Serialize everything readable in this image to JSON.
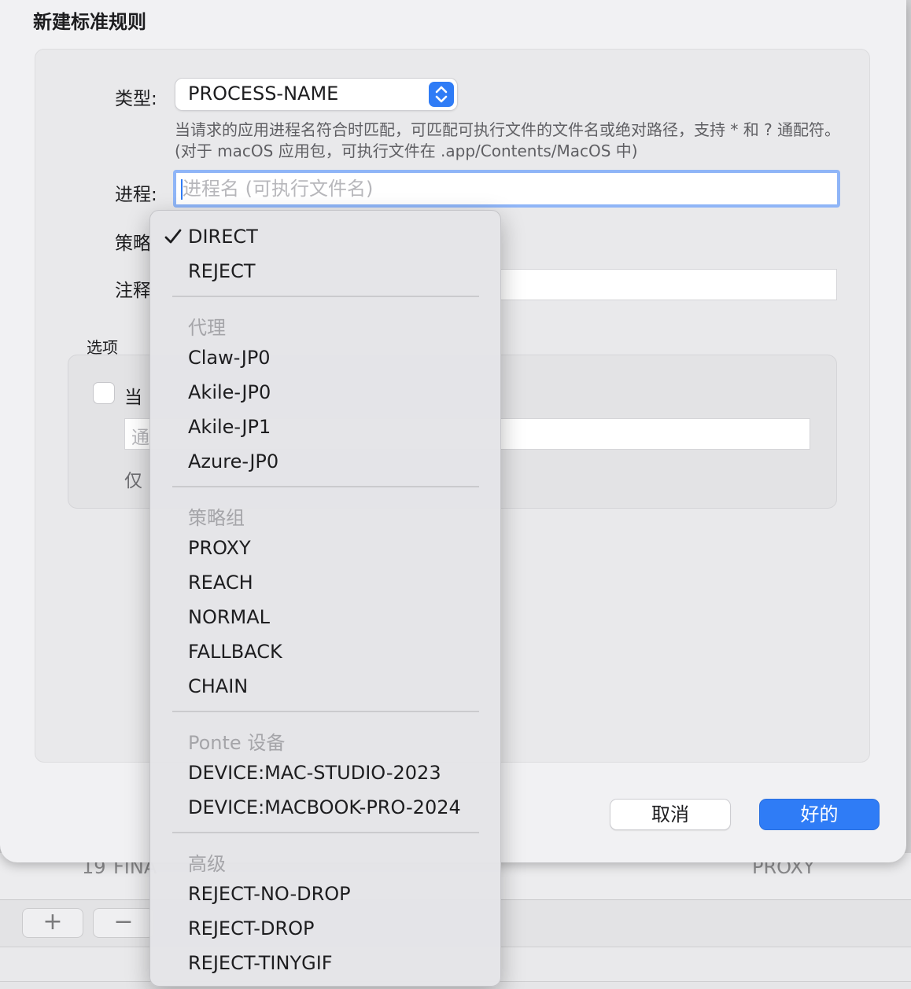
{
  "sheet": {
    "title": "新建标准规则",
    "type_label": "类型:",
    "type_value": "PROCESS-NAME",
    "help_text": "当请求的应用进程名符合时匹配，可匹配可执行文件的文件名或绝对路径，支持 * 和 ? 通配符。(对于 macOS 应用包，可执行文件在 .app/Contents/MacOS 中)",
    "process_label": "进程:",
    "process_placeholder": "进程名 (可执行文件名)",
    "policy_label": "策略",
    "comment_label": "注释",
    "options_label": "选项",
    "option_checkbox_text": "当",
    "option_input_placeholder": "通",
    "option_note": "仅",
    "cancel_label": "取消",
    "ok_label": "好的"
  },
  "menu": {
    "checked_item": "DIRECT",
    "items_top": [
      "DIRECT",
      "REJECT"
    ],
    "proxy_header": "代理",
    "proxies": [
      "Claw-JP0",
      "Akile-JP0",
      "Akile-JP1",
      "Azure-JP0"
    ],
    "group_header": "策略组",
    "groups": [
      "PROXY",
      "REACH",
      "NORMAL",
      "FALLBACK",
      "CHAIN"
    ],
    "ponte_header": "Ponte 设备",
    "devices": [
      "DEVICE:MAC-STUDIO-2023",
      "DEVICE:MACBOOK-PRO-2024"
    ],
    "advanced_header": "高级",
    "advanced": [
      "REJECT-NO-DROP",
      "REJECT-DROP",
      "REJECT-TINYGIF"
    ]
  },
  "background": {
    "row_number": "19",
    "row_type": "FINA",
    "row_policy": "PROXY",
    "add_symbol": "+",
    "remove_symbol": "−"
  },
  "colors": {
    "accent": "#2f7cf6",
    "focus_ring": "#8fb5f7"
  }
}
